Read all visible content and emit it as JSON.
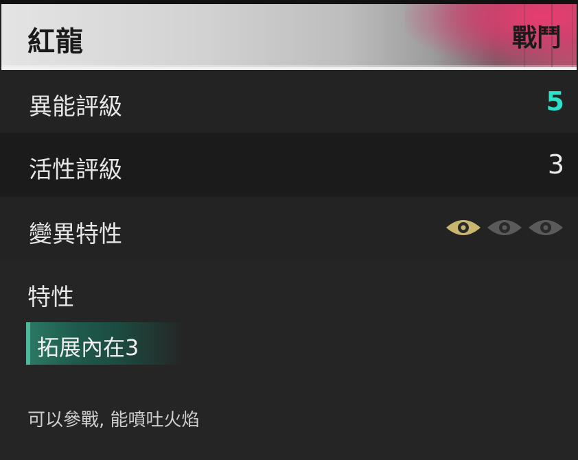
{
  "header": {
    "title": "紅龍",
    "tag": "戰鬥"
  },
  "stats": [
    {
      "label": "異能評級",
      "value": "5"
    },
    {
      "label": "活性評級",
      "value": "3"
    },
    {
      "label": "變異特性",
      "eyes_active": 1,
      "eyes_total": 3
    }
  ],
  "traits": {
    "heading": "特性",
    "items": [
      {
        "label": "拓展內在3"
      }
    ],
    "description": "可以參戰, 能噴吐火焰"
  },
  "colors": {
    "accent": "#2de0c8",
    "eye_active": "#c8b56e",
    "eye_inactive": "#5a5a5a",
    "header_pink": "#e03c6e",
    "trait_green": "#2c7a66"
  },
  "icons": {
    "eye": "eye-icon"
  }
}
